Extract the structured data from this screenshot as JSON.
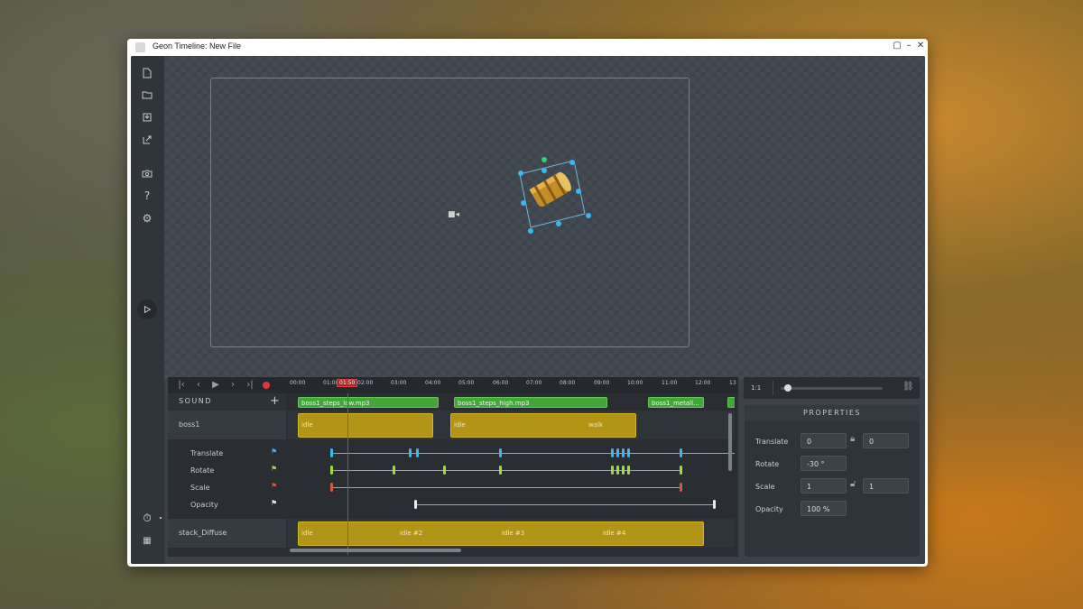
{
  "window": {
    "title": "Geon Timeline: New File",
    "controls": [
      "restore-icon",
      "minimize-icon",
      "close-icon"
    ]
  },
  "timeline": {
    "ruler_ticks": [
      "00:00",
      "01:00",
      "02:00",
      "03:00",
      "04:00",
      "05:00",
      "06:00",
      "07:00",
      "08:00",
      "09:00",
      "10:00",
      "11:00",
      "12:00",
      "13"
    ],
    "playhead_time": "01:50",
    "sound_label": "SOUND",
    "sound_clips": [
      "boss1_steps_low.mp3",
      "boss1_steps_high.mp3",
      "boss1_metall..."
    ],
    "boss1": {
      "name": "boss1",
      "clips": [
        "idle",
        "idle",
        "walk"
      ]
    },
    "properties_tracks": [
      "Translate",
      "Rotate",
      "Scale",
      "Opacity"
    ],
    "stack": {
      "name": "stack_Diffuse",
      "clips": [
        "idle",
        "idle #2",
        "idle #3",
        "idle #4"
      ]
    }
  },
  "zoom": {
    "label": "1:1",
    "level": 0.05
  },
  "properties": {
    "title": "PROPERTIES",
    "translate_label": "Translate",
    "translate_x": "0",
    "translate_y": "0",
    "rotate_label": "Rotate",
    "rotate": "-30 °",
    "scale_label": "Scale",
    "scale_x": "1",
    "scale_y": "1",
    "opacity_label": "Opacity",
    "opacity": "100 %"
  },
  "colors": {
    "accent_blue": "#38b8f0",
    "accent_green": "#9be03a",
    "accent_red": "#e0553a",
    "record": "#e0383a",
    "sound_clip": "#44a53d",
    "anim_clip": "#b29417"
  }
}
